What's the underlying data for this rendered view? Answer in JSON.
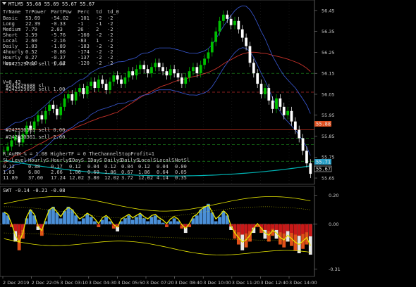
{
  "colors": {
    "background": "#000000",
    "grid": "#2a2a2a",
    "up_candle": "#00c000",
    "down_candle": "#ffffff",
    "envelope": "#3a5ad8",
    "ma_red": "#c8322a",
    "aqua": "#00b4b4",
    "yellow": "#e6e600",
    "bid_label": "#e05020",
    "ask_label": "#2aa0c8"
  },
  "main": {
    "header": "MTLM5  55.68 55.69 55.67 55.67",
    "table": {
      "columns": [
        "TrName",
        "TrPower",
        "PartPow",
        "Perc",
        "td",
        "td_0"
      ],
      "rows": [
        [
          "Basic",
          "53.69",
          "-54.02",
          "-101",
          "-2",
          "-2"
        ],
        [
          "Long",
          "22.39",
          "-0.33",
          "-1",
          "-1",
          "-2"
        ],
        [
          "Medium",
          "7.79",
          "2.03",
          "26",
          "2",
          "-2"
        ],
        [
          "Short",
          "3.59",
          "-5.76",
          "-160",
          "-2",
          "-2"
        ],
        [
          "Local",
          "2.60",
          "-2.16",
          "-83",
          "1",
          "-2"
        ],
        [
          "Daily",
          "1.03",
          "-1.89",
          "-183",
          "-2",
          "-2"
        ],
        [
          "4hourly",
          "0.52",
          "-0.86",
          "-174",
          "-2",
          "-2"
        ],
        [
          "Hourly",
          "0.27",
          "-0.37",
          "-137",
          "-2",
          "-2"
        ],
        [
          "Hour",
          "0.10",
          "-0.12",
          "-120",
          "-2",
          "-2"
        ]
      ]
    },
    "v_line": "V=0.43",
    "orders": [
      "#242529703 sell 1.00",
      "#242529688 sl",
      "#242529658 sell 1.00",
      "#242530361 sell 0.00",
      "#242530361 sell 2.00"
    ],
    "status": "R_AuMM_% = 1.08          HigherTF = 0        TheChannelStopProfit=1",
    "bottom_table": {
      "columns": [
        "SL_Level",
        "HourlyS",
        "HourlyS",
        "IDayS",
        "IDayS",
        "DailyS",
        "DailyS",
        "LocalS",
        "LocalS",
        "NotSl"
      ],
      "rows": [
        [
          "0.12",
          "0.38",
          "0.17",
          "0.12",
          "0.04",
          "0.12",
          "0.04",
          "0.12",
          "0.04",
          "0.00"
        ],
        [
          "1.03",
          "6.80",
          "2.66",
          "1.06",
          "0.69",
          "1.06",
          "0.67",
          "1.86",
          "0.64",
          "0.05"
        ],
        [
          "11.89",
          "37.60",
          "17.24",
          "12.02",
          "3.80",
          "12.02",
          "3.72",
          "12.02",
          "4.14",
          "0.35"
        ]
      ]
    },
    "y_ticks": [
      "56.45",
      "56.35",
      "56.25",
      "56.15",
      "56.05",
      "55.95",
      "55.85",
      "55.75",
      "55.65"
    ],
    "price_bid": "55.88",
    "price_ask": "55.71",
    "price_last": "55.67"
  },
  "sub": {
    "header": "SWT -0.14 -0.21 -0.08",
    "y_ticks": [
      "0.20",
      "0.00",
      "-0.31"
    ]
  },
  "time_axis": [
    "2 Dec 2019",
    "2 Dec 22:05",
    "3 Dec 03:10",
    "3 Dec 04:30",
    "3 Dec 05:50",
    "3 Dec 07:20",
    "3 Dec 08:40",
    "3 Dec 10:00",
    "3 Dec 11:20",
    "3 Dec 12:40",
    "3 Dec 14:00"
  ],
  "price_series": [
    55.78,
    55.8,
    55.83,
    55.85,
    55.82,
    55.86,
    55.9,
    55.88,
    55.92,
    55.95,
    55.93,
    55.97,
    56.0,
    55.98,
    55.95,
    55.99,
    56.03,
    56.05,
    56.02,
    56.06,
    56.08,
    56.05,
    56.09,
    56.11,
    56.08,
    56.12,
    56.1,
    56.07,
    56.11,
    56.14,
    56.12,
    56.1,
    56.13,
    56.16,
    56.14,
    56.17,
    56.19,
    56.17,
    56.15,
    56.18,
    56.2,
    56.18,
    56.16,
    56.14,
    56.17,
    56.15,
    56.13,
    56.1,
    56.13,
    56.16,
    56.18,
    56.15,
    56.19,
    56.22,
    56.25,
    56.3,
    56.35,
    56.4,
    56.43,
    56.41,
    56.38,
    56.4,
    56.36,
    56.32,
    56.28,
    56.2,
    56.15,
    56.1,
    56.05,
    56.08,
    56.02,
    55.98,
    56.03,
    55.99,
    55.95,
    55.97,
    55.92,
    55.88,
    55.84,
    55.78,
    55.72,
    55.67
  ],
  "oscillator": [
    0.08,
    0.06,
    -0.02,
    -0.12,
    -0.18,
    -0.1,
    0.04,
    0.1,
    0.06,
    -0.04,
    -0.08,
    0.02,
    0.1,
    0.12,
    0.08,
    0.04,
    0.09,
    0.12,
    0.1,
    0.06,
    0.02,
    0.04,
    0.07,
    0.05,
    0.02,
    -0.02,
    0.03,
    0.05,
    0.02,
    -0.03,
    -0.05,
    0.02,
    0.04,
    0.06,
    0.03,
    0.05,
    0.07,
    0.04,
    0.02,
    0.05,
    0.06,
    0.03,
    0.01,
    -0.02,
    0.02,
    0.04,
    0.02,
    -0.03,
    -0.06,
    -0.02,
    0.04,
    0.06,
    0.1,
    0.12,
    0.14,
    0.08,
    0.02,
    0.05,
    0.09,
    0.06,
    -0.04,
    -0.1,
    -0.14,
    -0.18,
    -0.16,
    -0.12,
    -0.06,
    -0.02,
    -0.06,
    -0.1,
    -0.12,
    -0.08,
    -0.1,
    -0.14,
    -0.16,
    -0.12,
    -0.15,
    -0.18,
    -0.2,
    -0.17,
    -0.14,
    -0.21
  ]
}
